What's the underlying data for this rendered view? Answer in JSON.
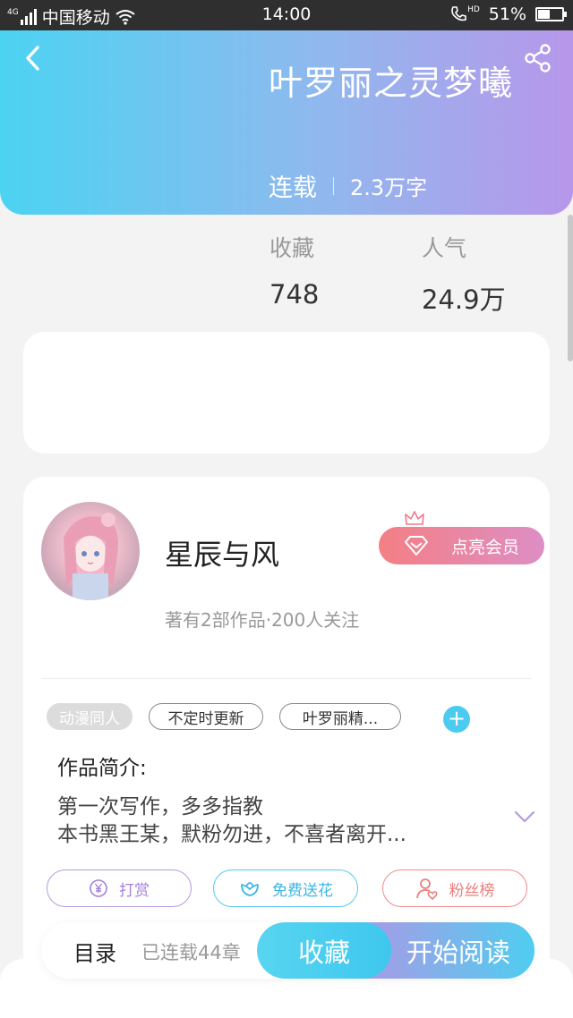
{
  "status_bar": {
    "network": "4G",
    "carrier": "中国移动",
    "time": "14:00",
    "hd_label": "HD",
    "battery_percent": "51%",
    "battery_level": 0.51
  },
  "header": {
    "book_title": "叶罗丽之灵梦曦",
    "serial_status": "连载",
    "word_count": "2.3万字"
  },
  "stats": {
    "favorites_label": "收藏",
    "favorites_value": "748",
    "popularity_label": "人气",
    "popularity_value": "24.9万"
  },
  "author": {
    "name": "星辰与风",
    "info": "著有2部作品·200人关注",
    "vip_button": "点亮会员"
  },
  "tags": [
    "动漫同人",
    "不定时更新",
    "叶罗丽精..."
  ],
  "intro": {
    "title": "作品简介:",
    "line1": "第一次写作，多多指教",
    "line2": "本书黑王某，默粉勿进，不喜者离开..."
  },
  "actions": {
    "reward": "打赏",
    "flower": "免费送花",
    "fans": "粉丝榜"
  },
  "bottom_bar": {
    "toc_label": "目录",
    "chapter_count": "已连载44章",
    "collect_button": "收藏",
    "read_button": "开始阅读"
  },
  "colors": {
    "header_gradient_start": "#4cd3f2",
    "header_gradient_end": "#b797ea",
    "accent_blue": "#4ccbf0",
    "accent_purple": "#a57fdc",
    "accent_red": "#ef7d7d"
  },
  "icons": [
    "back-icon",
    "share-icon",
    "crown-icon",
    "diamond-icon",
    "plus-icon",
    "chevron-down-icon",
    "yen-icon",
    "flower-icon",
    "user-heart-icon",
    "wifi-icon",
    "signal-icon",
    "phone-icon",
    "battery-icon"
  ]
}
